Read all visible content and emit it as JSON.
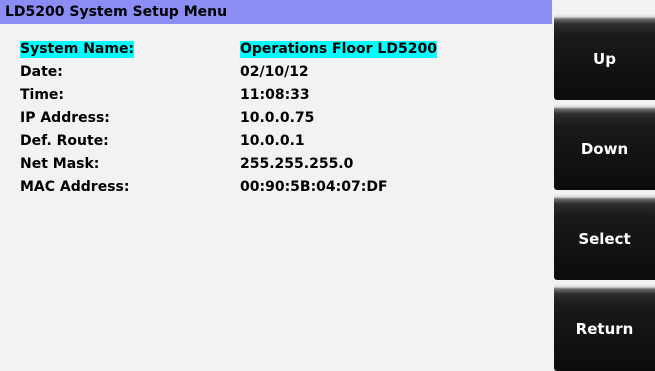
{
  "title": "LD5200 System Setup Menu",
  "fields": [
    {
      "label": "System Name:",
      "value": "Operations Floor LD5200",
      "selected": true
    },
    {
      "label": "Date:",
      "value": "02/10/12",
      "selected": false
    },
    {
      "label": "Time:",
      "value": "11:08:33",
      "selected": false
    },
    {
      "label": "IP Address:",
      "value": "10.0.0.75",
      "selected": false
    },
    {
      "label": "Def. Route:",
      "value": "10.0.0.1",
      "selected": false
    },
    {
      "label": "Net Mask:",
      "value": "255.255.255.0",
      "selected": false
    },
    {
      "label": "MAC Address:",
      "value": "00:90:5B:04:07:DF",
      "selected": false
    }
  ],
  "buttons": {
    "up": "Up",
    "down": "Down",
    "select": "Select",
    "return": "Return"
  },
  "colors": {
    "title_bar": "#8c8cf5",
    "highlight": "#00ffff",
    "background": "#f2f2f2",
    "button": "#111111"
  }
}
